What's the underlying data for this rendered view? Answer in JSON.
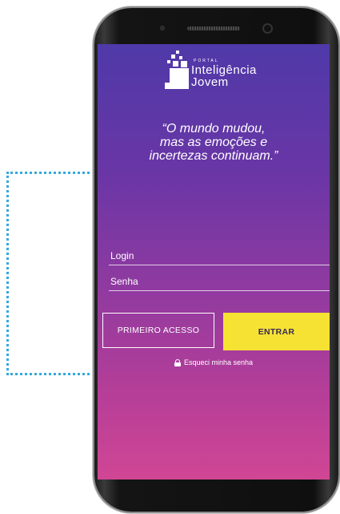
{
  "logo": {
    "top_text": "PORTAL",
    "line1": "Inteligência",
    "line2": "Jovem"
  },
  "quote": {
    "line1": "“O mundo mudou,",
    "line2": "mas as emoções e",
    "line3": "incertezas continuam.”"
  },
  "form": {
    "login_placeholder": "Login",
    "senha_placeholder": "Senha"
  },
  "buttons": {
    "primeiro_acesso": "PRIMEIRO ACESSO",
    "entrar": "ENTRAR"
  },
  "forgot_password": "Esqueci minha senha",
  "colors": {
    "gradient_top": "#4f39a8",
    "gradient_bottom": "#d04694",
    "entrar_button": "#f6e233",
    "dotted_frame": "#35a9dd"
  }
}
